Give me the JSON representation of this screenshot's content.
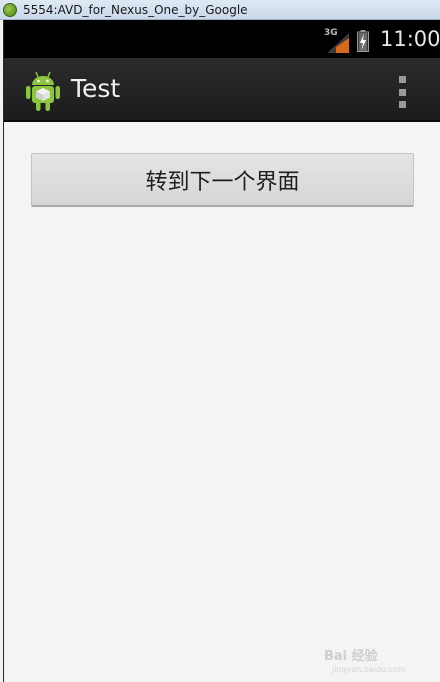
{
  "window": {
    "title": "5554:AVD_for_Nexus_One_by_Google"
  },
  "status_bar": {
    "network_type": "3G",
    "time": "11:00",
    "icons": [
      "signal-icon",
      "battery-charging-icon"
    ]
  },
  "action_bar": {
    "title": "Test",
    "app_icon": "android-icon",
    "menu_icon": "overflow-menu-icon"
  },
  "main": {
    "button_label": "转到下一个界面"
  },
  "watermark": {
    "text": "Bai 经验",
    "sub": "jingyan.baidu.com"
  },
  "colors": {
    "status_bar_bg": "#000000",
    "action_bar_bg": "#222222",
    "content_bg": "#f4f4f4",
    "button_bg": "#dcdcdc"
  }
}
